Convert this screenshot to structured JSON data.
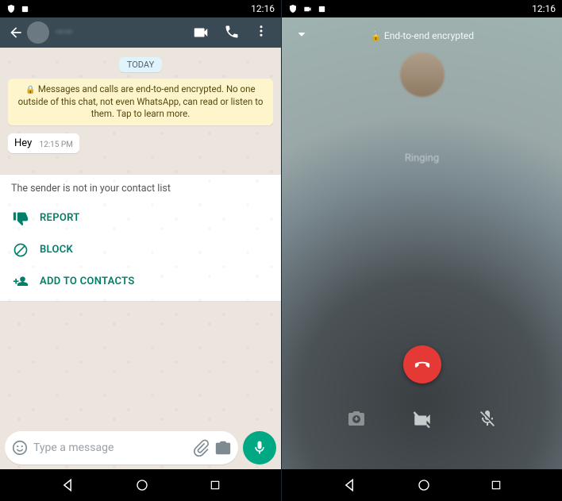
{
  "left": {
    "statusbar": {
      "time": "12:16"
    },
    "chat": {
      "date_label": "TODAY",
      "encryption_notice": "Messages and calls are end-to-end encrypted. No one outside of this chat, not even WhatsApp, can read or listen to them. Tap to learn more.",
      "messages": [
        {
          "text": "Hey",
          "time": "12:15 PM"
        }
      ],
      "unknown_sender_note": "The sender is not in your contact list",
      "actions": {
        "report": "REPORT",
        "block": "BLOCK",
        "add": "ADD TO CONTACTS"
      },
      "input_placeholder": "Type a message"
    }
  },
  "right": {
    "statusbar": {
      "time": "12:16"
    },
    "call": {
      "encryption_label": "End-to-end encrypted",
      "status": "Ringing"
    }
  }
}
